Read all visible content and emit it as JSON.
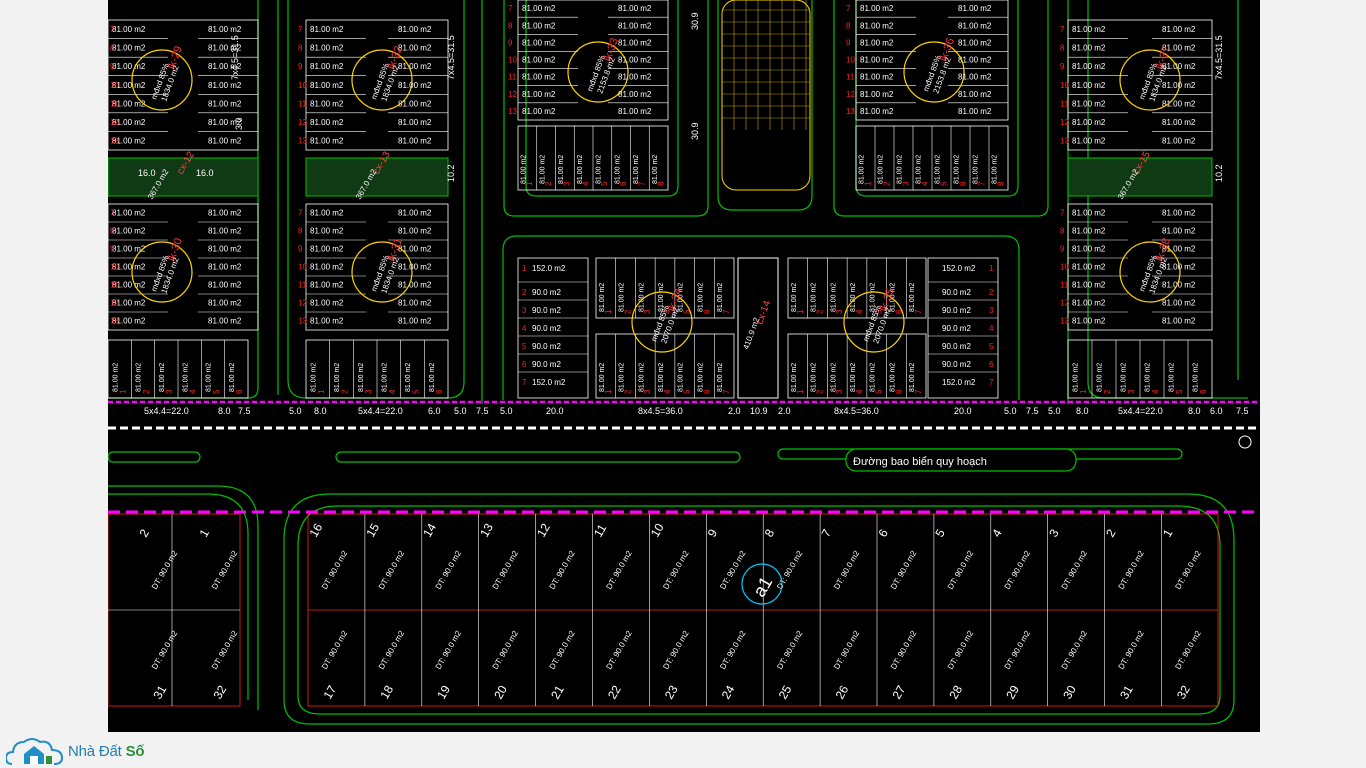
{
  "map": {
    "road_label": "Đường bao biển quy hoạch",
    "marker_label": "a1",
    "upper_blocks": [
      {
        "name": "lk-29",
        "area": "1834.0 m2",
        "info": "mđxd 85%"
      },
      {
        "name": "lk-32",
        "area": "1834.0 m2",
        "info": "mđxd 85%"
      },
      {
        "name": "lk-33",
        "area": "2153.8 m2",
        "info": "mđxd 85%"
      },
      {
        "name": "lk-36",
        "area": "2153.8 m2",
        "info": "mđxd 85%"
      },
      {
        "name": "lk-37",
        "area": "1834.0 m2",
        "info": "mđxd 85%"
      },
      {
        "name": "lk-30",
        "area": "1834.0 m2",
        "info": "mđxd 85%"
      },
      {
        "name": "lk-31",
        "area": "1834.0 m2",
        "info": "mđxd 85%"
      },
      {
        "name": "lk-34",
        "area": "2070.0 m2",
        "info": "mđxd 85%"
      },
      {
        "name": "lk-35",
        "area": "2070.0 m2",
        "info": "mđxd 85%"
      },
      {
        "name": "lk-38",
        "area": "1834.0 m2",
        "info": "mđxd 85%"
      }
    ],
    "green_strips": [
      {
        "name": "cx-12",
        "area": "367.0 m2"
      },
      {
        "name": "cx-13",
        "area": "367.0 m2"
      },
      {
        "name": "cx-14",
        "area": "410.9 m2"
      },
      {
        "name": "cx-15",
        "area": "367.0 m2"
      }
    ],
    "lot_area_label": "81.00 m2",
    "large_lot_label": "152.0 m2",
    "mid_lot_label": "90.0 m2",
    "dimension_labels": [
      "5x4.4=22.0",
      "8.0",
      "6.0",
      "7.5",
      "5.0",
      "20.0",
      "8x4.5=36.0",
      "2.0",
      "10.9",
      "3.0",
      "10.2",
      "16.0",
      "7x4.5=31.5",
      "30.9"
    ],
    "lower_top_row": [
      "2",
      "1",
      "16",
      "15",
      "14",
      "13",
      "12",
      "11",
      "10",
      "9",
      "8",
      "7",
      "6",
      "5",
      "4",
      "3",
      "2",
      "1"
    ],
    "lower_bottom_row": [
      "31",
      "32",
      "17",
      "18",
      "19",
      "20",
      "21",
      "22",
      "23",
      "24",
      "25",
      "26",
      "27",
      "28",
      "29",
      "30",
      "31",
      "32"
    ],
    "lower_area_label": "DT: 90.0 m2"
  },
  "logo": {
    "brand_text": "Nhà Đất",
    "brand_suffix": "Số",
    "icon": "house-cloud-icon"
  },
  "colors": {
    "background": "#000000",
    "lot_line": "#ffffff",
    "road_edge": "#00c000",
    "boundary": "#ff00ff",
    "lot_number": "#ff2020",
    "block_circle": "#ffd400",
    "cad_text": "#ffffff"
  }
}
